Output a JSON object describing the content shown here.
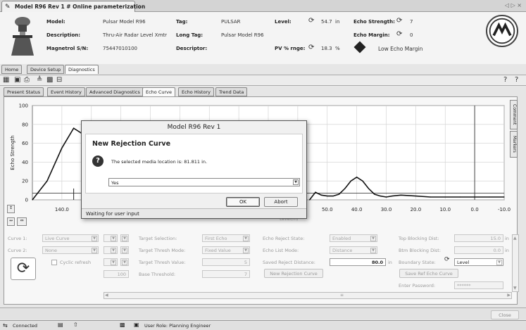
{
  "window": {
    "tab_title": "Model R96 Rev 1 # Online parameterization",
    "nav": "◁ ▷ ×"
  },
  "header": {
    "model_label": "Model:",
    "model_value": "Pulsar Model R96",
    "description_label": "Description:",
    "description_value": "Thru-Air Radar Level Xmtr",
    "serial_label": "Magnetrol S/N:",
    "serial_value": "75447010100",
    "tag_label": "Tag:",
    "tag_value": "PULSAR",
    "longtag_label": "Long Tag:",
    "longtag_value": "Pulsar Model R96",
    "descriptor_label": "Descriptor:",
    "descriptor_value": "",
    "level_label": "Level:",
    "level_value": "54.7",
    "level_unit": "in",
    "pvrange_label": "PV % rnge:",
    "pvrange_value": "18.3",
    "pvrange_unit": "%",
    "echo_strength_label": "Echo Strength:",
    "echo_strength_value": "7",
    "echo_margin_label": "Echo Margin:",
    "echo_margin_value": "0",
    "status_text": "Low Echo Margin"
  },
  "main_tabs": [
    "Home",
    "Device Setup",
    "Diagnostics"
  ],
  "sub_tabs": [
    "Present Status",
    "Event History",
    "Advanced Diagnostics",
    "Echo Curve",
    "Echo History",
    "Trend Data"
  ],
  "side_tabs": [
    "Comment",
    "Markers"
  ],
  "chart": {
    "ylabel": "Echo Strength",
    "yticks": [
      "100",
      "80",
      "60",
      "40",
      "20",
      "0"
    ],
    "xticks": [
      "140.0",
      "50.0",
      "40.0",
      "30.0",
      "20.0",
      "10.0",
      "0.0",
      "-10.0"
    ],
    "partial_label": "Level(m)",
    "colors": {
      "curve": "#111111",
      "grid": "#cfcfcf",
      "threshold": "#222222"
    }
  },
  "chart_data": {
    "type": "line",
    "xlabel": "",
    "ylabel": "Echo Strength",
    "xlim": [
      150,
      -10
    ],
    "ylim": [
      0,
      100
    ],
    "series": [
      {
        "x": [
          150,
          145,
          140,
          136,
          132,
          128,
          124,
          120,
          116,
          112,
          108,
          104
        ],
        "y": [
          0,
          20,
          55,
          76,
          68,
          45,
          28,
          16,
          9,
          6,
          4,
          3
        ]
      },
      {
        "x": [
          56,
          54,
          52,
          50,
          48,
          46,
          44,
          42,
          40,
          38,
          36,
          34,
          32,
          30,
          28,
          25,
          20,
          15,
          10,
          5,
          0,
          -5,
          -10
        ],
        "y": [
          0,
          8,
          5,
          4,
          4,
          6,
          12,
          20,
          24,
          20,
          12,
          6,
          4,
          3,
          4,
          5,
          4,
          3,
          3,
          3,
          3,
          3,
          3
        ]
      }
    ]
  },
  "dialog": {
    "title": "Model R96 Rev 1",
    "heading": "New Rejection Curve",
    "message": "The selected media location is: 81.811 in.",
    "select_value": "Yes",
    "ok_label": "OK",
    "abort_label": "Abort",
    "footer": "Waiting for user input"
  },
  "controls": {
    "curve1_label": "Curve 1:",
    "curve1_value": "Live Curve",
    "curve2_label": "Curve 2:",
    "curve2_value": "None",
    "cyclic_label": "Cyclic refresh",
    "base_value": "100",
    "target_sel_label": "Target Selection:",
    "target_sel_value": "First Echo",
    "target_mode_label": "Target Thresh Mode:",
    "target_mode_value": "Fixed Value",
    "target_val_label": "Target Thresh Value:",
    "target_val_value": "5",
    "base_thresh_label": "Base Threshold:",
    "base_thresh_value": "7",
    "echo_reject_label": "Echo Reject State:",
    "echo_reject_value": "Enabled",
    "echo_list_label": "Echo List Mode:",
    "echo_list_value": "Distance",
    "saved_reject_label": "Saved Reject Distance:",
    "saved_reject_value": "80.0",
    "saved_reject_unit": "in",
    "new_reject_button": "New Rejection Curve",
    "top_block_label": "Top Blocking Dist:",
    "top_block_value": "15.0",
    "top_block_unit": "in",
    "btm_block_label": "Btm Blocking Dist:",
    "btm_block_value": "0.0",
    "btm_block_unit": "in",
    "boundary_label": "Boundary State:",
    "boundary_value": "Level",
    "save_ref_button": "Save Ref Echo Curve",
    "password_label": "Enter Password:",
    "password_value": "******"
  },
  "close_button": "Close",
  "status": {
    "connected": "Connected",
    "user": "User Role: Planning Engineer"
  }
}
